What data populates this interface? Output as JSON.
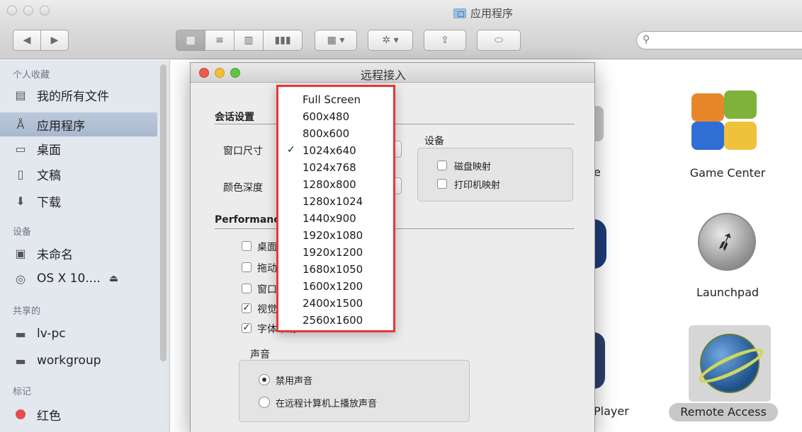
{
  "window": {
    "title": "应用程序"
  },
  "toolbar": {
    "view_icons": [
      "icon-view",
      "list-view",
      "column-view",
      "coverflow-view"
    ],
    "search_placeholder": ""
  },
  "sidebar": {
    "sections": [
      {
        "header": "个人收藏",
        "items": [
          {
            "label": "我的所有文件",
            "icon": "all-files-icon"
          },
          {
            "label": "应用程序",
            "icon": "applications-icon",
            "selected": true
          },
          {
            "label": "桌面",
            "icon": "desktop-icon"
          },
          {
            "label": "文稿",
            "icon": "documents-icon"
          },
          {
            "label": "下载",
            "icon": "downloads-icon"
          }
        ]
      },
      {
        "header": "设备",
        "items": [
          {
            "label": "未命名",
            "icon": "disk-icon"
          },
          {
            "label": "OS X 10....",
            "icon": "dvd-icon",
            "eject": "⏏"
          }
        ]
      },
      {
        "header": "共享的",
        "items": [
          {
            "label": "lv-pc",
            "icon": "computer-icon"
          },
          {
            "label": "workgroup",
            "icon": "computer-icon"
          }
        ]
      },
      {
        "header": "标记",
        "items": [
          {
            "label": "红色",
            "icon": "red-tag-icon",
            "color": "#e74c4c"
          }
        ]
      }
    ]
  },
  "apps": {
    "game_center": "Game Center",
    "launchpad": "Launchpad",
    "remote_access": "Remote Access",
    "partial_e": "e",
    "partial_player": "Player"
  },
  "dialog": {
    "title": "远程接入",
    "session_section": "会话设置",
    "window_size_label": "窗口尺寸",
    "color_depth_label": "颜色深度",
    "device_section": "设备",
    "disk_mapping": "磁盘映射",
    "printer_mapping": "打印机映射",
    "performance_section": "Performance",
    "perf_options": [
      {
        "label": "桌面背景",
        "checked": false
      },
      {
        "label": "拖动时显示",
        "checked": false
      },
      {
        "label": "窗口和菜单",
        "checked": false
      },
      {
        "label": "视觉样式",
        "checked": true
      },
      {
        "label": "字体平滑",
        "checked": true
      }
    ],
    "sound_section": "声音",
    "sound_options": [
      {
        "label": "禁用声音",
        "selected": true
      },
      {
        "label": "在远程计算机上播放声音",
        "selected": false
      }
    ]
  },
  "resolution_menu": {
    "items": [
      "Full Screen",
      "600x480",
      "800x600",
      "1024x640",
      "1024x768",
      "1280x800",
      "1280x1024",
      "1440x900",
      "1920x1080",
      "1920x1200",
      "1680x1050",
      "1600x1200",
      "2400x1500",
      "2560x1600"
    ],
    "checked_index": 3,
    "check_mark": "✓",
    "highlight_color": "#e53935"
  }
}
